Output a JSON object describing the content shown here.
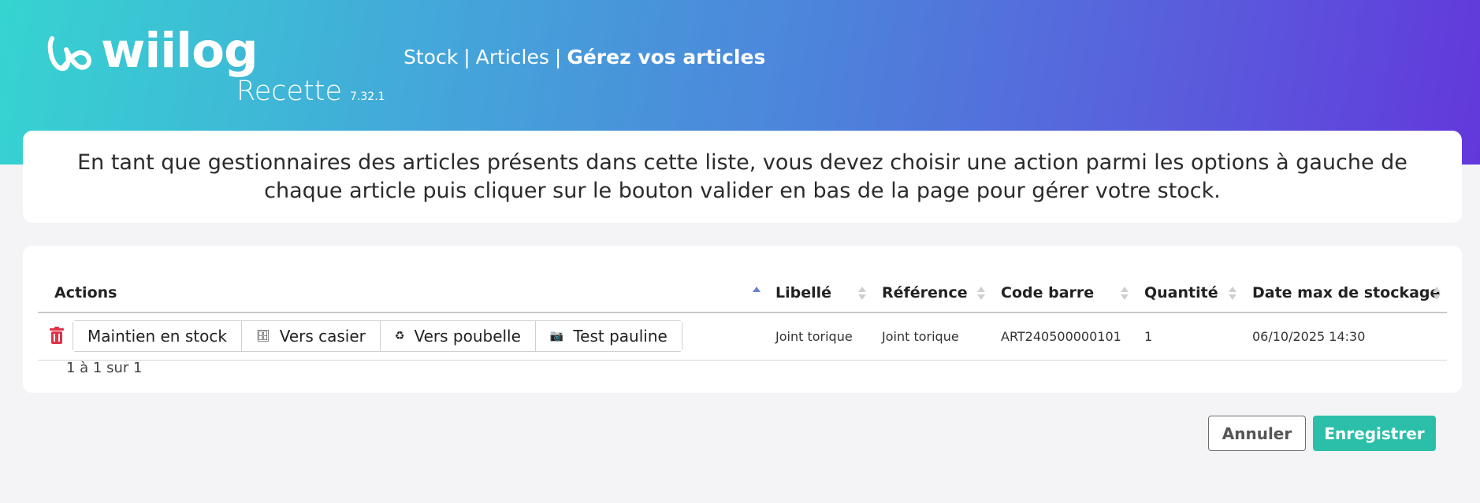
{
  "header": {
    "logo_text": "wiilog",
    "environment": "Recette",
    "version": "7.32.1",
    "breadcrumb": {
      "part1": "Stock",
      "sep1": "|",
      "part2": "Articles",
      "sep2": "|",
      "current": "Gérez vos articles"
    }
  },
  "info": {
    "text": "En tant que gestionnaires des articles présents dans cette liste, vous devez choisir une action parmi les options à gauche de chaque article puis cliquer sur le bouton valider en bas de la page pour gérer votre stock."
  },
  "table": {
    "columns": {
      "actions": "Actions",
      "libelle": "Libellé",
      "reference": "Référence",
      "code_barre": "Code barre",
      "quantite": "Quantité",
      "date_max": "Date max de stockage"
    },
    "rows": [
      {
        "actions": {
          "maintien": "Maintien en stock",
          "casier": "Vers casier",
          "poubelle": "Vers poubelle",
          "test": "Test pauline"
        },
        "libelle": "Joint torique",
        "reference": "Joint torique",
        "code_barre": "ART240500000101",
        "quantite": "1",
        "date_max": "06/10/2025 14:30"
      }
    ],
    "pagination": "1 à 1 sur 1"
  },
  "footer": {
    "cancel_label": "Annuler",
    "save_label": "Enregistrer"
  },
  "colors": {
    "gradient_start": "#36d4d1",
    "gradient_end": "#6238db",
    "primary_button": "#2bbfa9",
    "delete_icon": "#e0334a"
  }
}
